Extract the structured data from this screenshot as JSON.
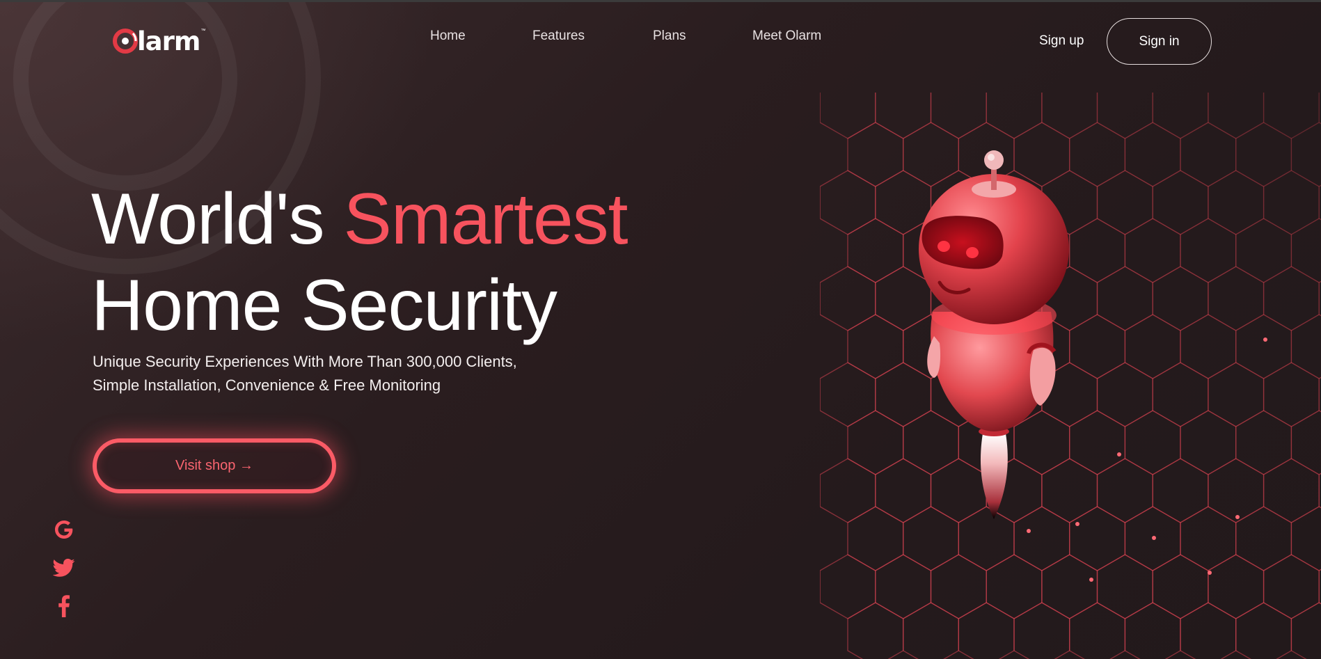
{
  "brand": {
    "name": "larm",
    "trademark": "™",
    "logo_icon": "olarm-logo-icon",
    "accent_color": "#f7535e",
    "background_color": "#241a1c"
  },
  "nav": {
    "items": [
      {
        "label": "Home"
      },
      {
        "label": "Features"
      },
      {
        "label": "Plans"
      },
      {
        "label": "Meet Olarm"
      }
    ]
  },
  "auth": {
    "signup_label": "Sign up",
    "signin_label": "Sign in"
  },
  "hero": {
    "title_part1": "World's ",
    "title_accent": "Smartest",
    "title_line2": "Home Security",
    "subtitle_line1": "Unique Security Experiences With More Than 300,000 Clients,",
    "subtitle_line2": "Simple Installation, Convenience & Free Monitoring",
    "cta_label": "Visit shop →"
  },
  "social": {
    "icons": [
      "google-icon",
      "twitter-icon",
      "facebook-icon"
    ],
    "icon_color": "#f7535e"
  },
  "illustration": {
    "icon": "robot-illustration"
  }
}
